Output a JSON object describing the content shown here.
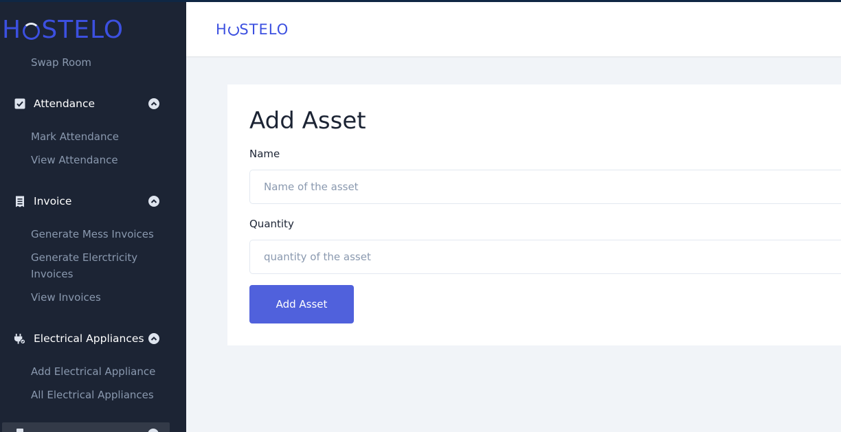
{
  "brand": {
    "logo_pre": "H",
    "logo_post": "STELO",
    "accent": "#3c50e0"
  },
  "sidebar": {
    "top_item": "Swap Room",
    "groups": [
      {
        "label": "Attendance",
        "icon": "check-square-icon",
        "items": [
          "Mark Attendance",
          "View Attendance"
        ]
      },
      {
        "label": "Invoice",
        "icon": "receipt-icon",
        "items": [
          "Generate Mess Invoices",
          "Generate Elerctricity",
          "Invoices",
          "View Invoices"
        ]
      },
      {
        "label": "Electrical Appliances",
        "icon": "plug-icon",
        "items": [
          "Add Electrical Appliance",
          "All Electrical Appliances"
        ]
      }
    ]
  },
  "form": {
    "title": "Add Asset",
    "name_label": "Name",
    "name_placeholder": "Name of the asset",
    "quantity_label": "Quantity",
    "quantity_placeholder": "quantity of the asset",
    "submit": "Add Asset"
  }
}
